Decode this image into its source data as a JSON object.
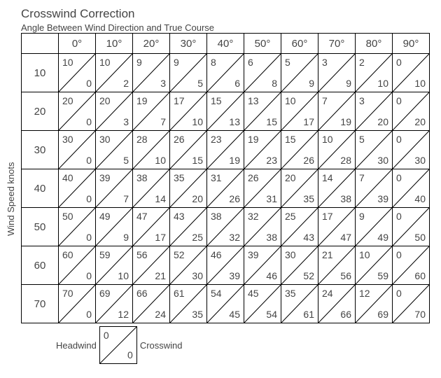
{
  "title": "Crosswind Correction",
  "subtitle": "Angle Between Wind Direction and True Course",
  "ylabel": "Wind Speed knots",
  "legend": {
    "head_label": "Headwind",
    "cross_label": "Crosswind",
    "hw": "0",
    "cw": "0"
  },
  "chart_data": {
    "type": "table",
    "title": "Crosswind Correction",
    "xlabel": "Angle Between Wind Direction and True Course",
    "ylabel": "Wind Speed knots",
    "angles": [
      "0°",
      "10°",
      "20°",
      "30°",
      "40°",
      "50°",
      "60°",
      "70°",
      "80°",
      "90°"
    ],
    "speeds": [
      "10",
      "20",
      "30",
      "40",
      "50",
      "60",
      "70"
    ],
    "headwind": [
      [
        10,
        10,
        9,
        9,
        8,
        6,
        5,
        3,
        2,
        0
      ],
      [
        20,
        20,
        19,
        17,
        15,
        13,
        10,
        7,
        3,
        0
      ],
      [
        30,
        30,
        28,
        26,
        23,
        19,
        15,
        10,
        5,
        0
      ],
      [
        40,
        39,
        38,
        35,
        31,
        26,
        20,
        14,
        7,
        0
      ],
      [
        50,
        49,
        47,
        43,
        38,
        32,
        25,
        17,
        9,
        0
      ],
      [
        60,
        59,
        56,
        52,
        46,
        39,
        30,
        21,
        10,
        0
      ],
      [
        70,
        69,
        66,
        61,
        54,
        45,
        35,
        24,
        12,
        0
      ]
    ],
    "crosswind": [
      [
        0,
        2,
        3,
        5,
        6,
        8,
        9,
        9,
        10,
        10
      ],
      [
        0,
        3,
        7,
        10,
        13,
        15,
        17,
        19,
        20,
        20
      ],
      [
        0,
        5,
        10,
        15,
        19,
        23,
        26,
        28,
        30,
        30
      ],
      [
        0,
        7,
        14,
        20,
        26,
        31,
        35,
        38,
        39,
        40
      ],
      [
        0,
        9,
        17,
        25,
        32,
        38,
        43,
        47,
        49,
        50
      ],
      [
        0,
        10,
        21,
        30,
        39,
        46,
        52,
        56,
        59,
        60
      ],
      [
        0,
        12,
        24,
        35,
        45,
        54,
        61,
        66,
        69,
        70
      ]
    ]
  }
}
